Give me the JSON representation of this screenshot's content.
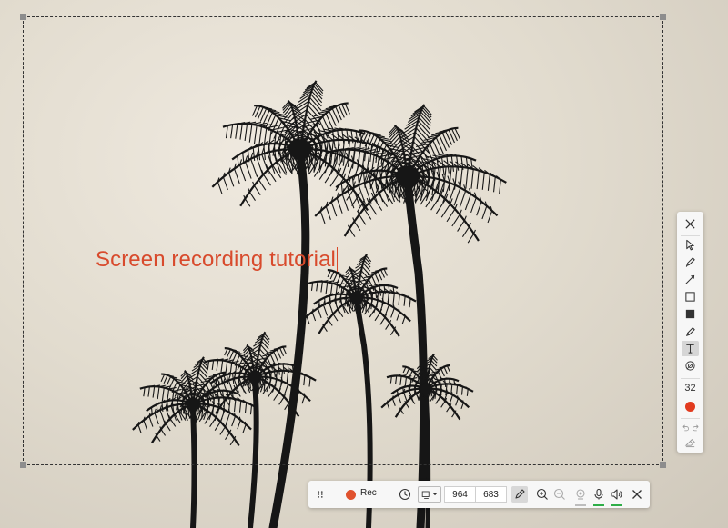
{
  "annotation": {
    "text": "Screen recording tutorial"
  },
  "tool_panel": {
    "tools": [
      {
        "name": "close",
        "icon": "close-icon"
      },
      {
        "name": "select",
        "icon": "cursor-icon"
      },
      {
        "name": "pen",
        "icon": "pen-icon"
      },
      {
        "name": "arrow",
        "icon": "arrow-icon"
      },
      {
        "name": "rectangle",
        "icon": "rectangle-icon"
      },
      {
        "name": "filled-rectangle",
        "icon": "filled-rectangle-icon"
      },
      {
        "name": "highlighter",
        "icon": "highlighter-icon"
      },
      {
        "name": "text",
        "icon": "text-icon",
        "active": true
      },
      {
        "name": "blur",
        "icon": "blur-icon"
      }
    ],
    "font_size": "32",
    "color": "#e23b1f",
    "history": [
      "undo-icon",
      "redo-icon"
    ],
    "eraser_icon": "eraser-icon"
  },
  "toolbar": {
    "rec_label": "Rec",
    "width": "964",
    "height": "683",
    "icons": [
      "drag-handle-icon",
      "record-icon",
      "timer-icon",
      "screen-select-icon",
      "pencil-edit-icon",
      "zoom-in-icon",
      "zoom-out-icon",
      "webcam-icon",
      "microphone-icon",
      "speaker-icon",
      "close-icon"
    ],
    "accent": "#2fae48",
    "record_color": "#e0522e"
  }
}
